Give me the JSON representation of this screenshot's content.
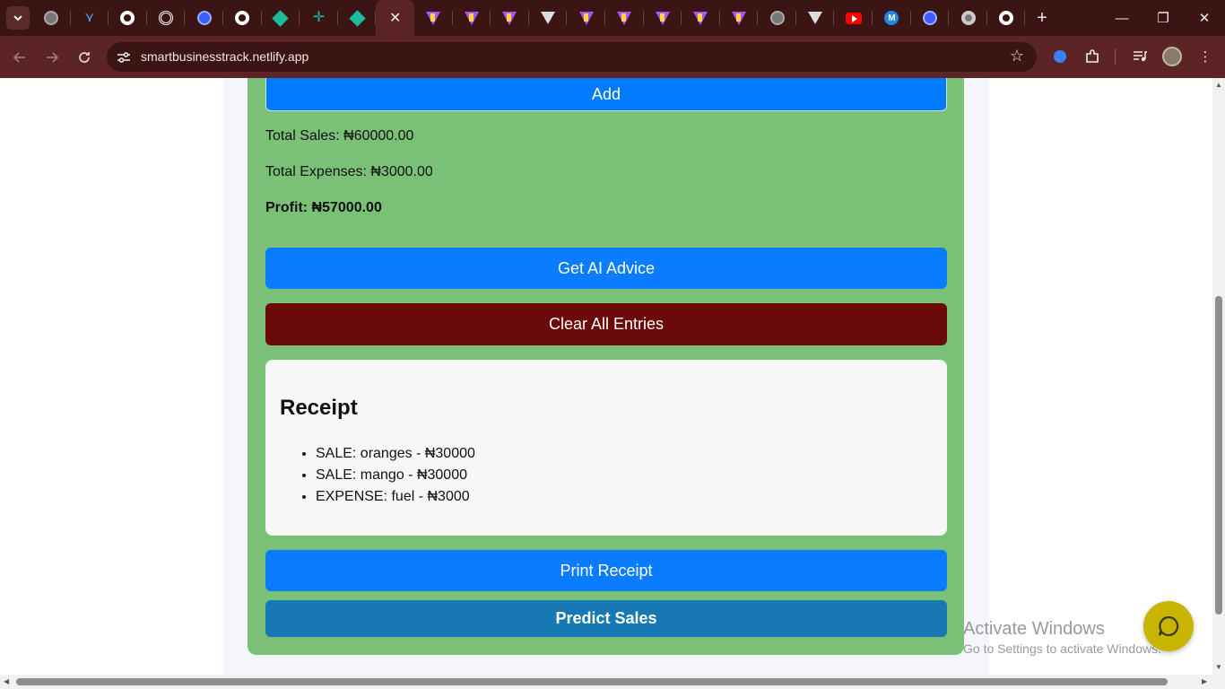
{
  "browser": {
    "url": "smartbusinesstrack.netlify.app",
    "tabs": [
      {
        "icon": "globe-icon"
      },
      {
        "icon": "arrow-icon"
      },
      {
        "icon": "github-icon"
      },
      {
        "icon": "openai-icon"
      },
      {
        "icon": "react-icon"
      },
      {
        "icon": "github-icon"
      },
      {
        "icon": "diamond-icon"
      },
      {
        "icon": "cross-icon"
      },
      {
        "icon": "diamond-icon"
      },
      {
        "icon": "close-icon",
        "active": true
      },
      {
        "icon": "vite-icon"
      },
      {
        "icon": "vite-icon"
      },
      {
        "icon": "vite-icon"
      },
      {
        "icon": "vercel-icon"
      },
      {
        "icon": "vite-icon"
      },
      {
        "icon": "vite-icon"
      },
      {
        "icon": "vite-icon"
      },
      {
        "icon": "vite-icon"
      },
      {
        "icon": "vite-icon"
      },
      {
        "icon": "globe-icon"
      },
      {
        "icon": "vercel-icon"
      },
      {
        "icon": "youtube-icon"
      },
      {
        "icon": "m-icon"
      },
      {
        "icon": "react-icon"
      },
      {
        "icon": "chrome-icon"
      },
      {
        "icon": "github-icon"
      }
    ],
    "new_tab_label": "+",
    "controls": {
      "minimize": "—",
      "restore": "❐",
      "close": "✕"
    }
  },
  "app": {
    "add_button": "Add",
    "total_sales": "Total Sales: ₦60000.00",
    "total_expenses": "Total Expenses: ₦3000.00",
    "profit": "Profit: ₦57000.00",
    "ai_advice_button": "Get AI Advice",
    "clear_button": "Clear All Entries",
    "receipt": {
      "title": "Receipt",
      "items": [
        "SALE: oranges - ₦30000",
        "SALE: mango - ₦30000",
        "EXPENSE: fuel - ₦3000"
      ]
    },
    "print_button": "Print Receipt",
    "predict_button": "Predict Sales"
  },
  "overlay": {
    "activate_title": "Activate Windows",
    "activate_sub": "Go to Settings to activate Windows."
  },
  "colors": {
    "card": "#7bc077",
    "primary": "#007bff",
    "danger": "#6a0a0a",
    "predict": "#1878b4",
    "chrome": "#3b1414"
  }
}
